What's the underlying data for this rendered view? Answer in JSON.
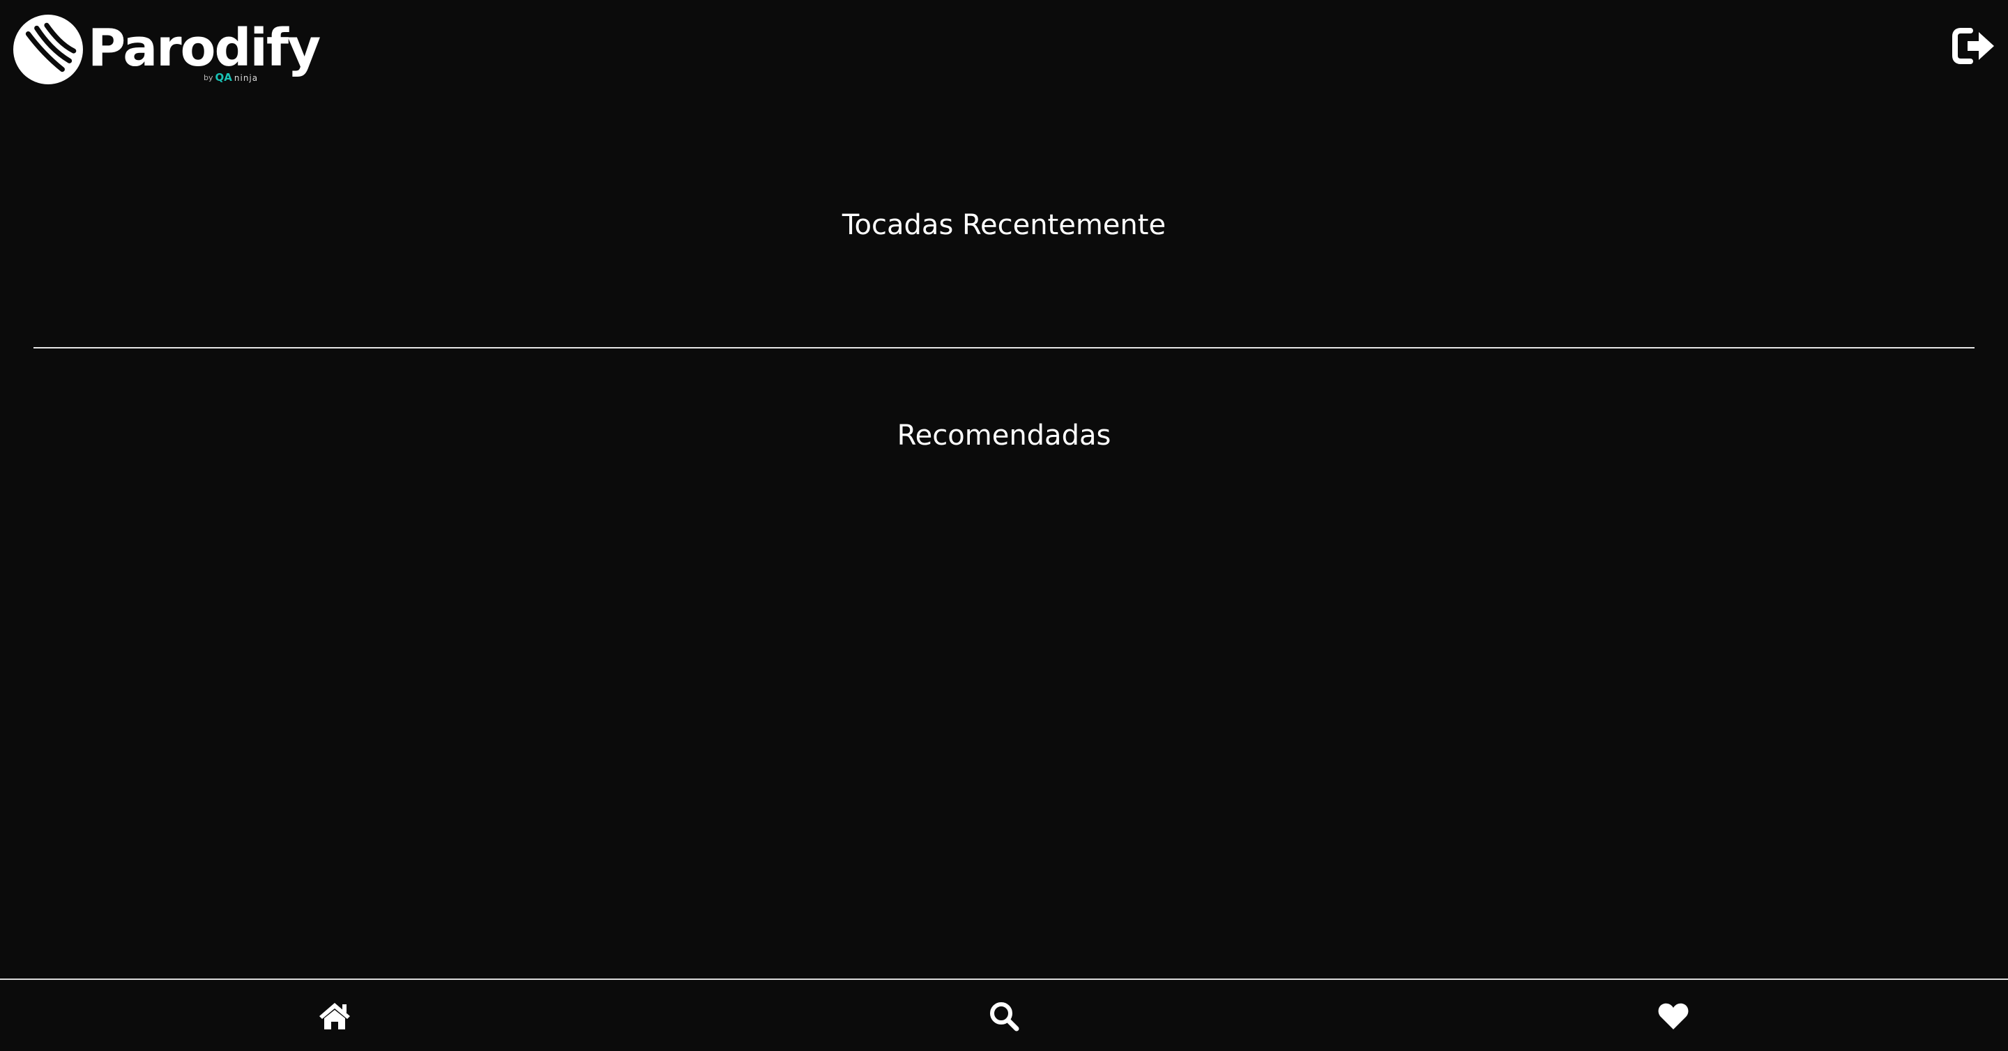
{
  "header": {
    "logo": {
      "name": "Parodify",
      "byline_prefix": "by",
      "byline_brand_accent": "QA",
      "byline_brand_rest": "ninja",
      "accent_color": "#19c2b5"
    },
    "logout_icon": "sign-out-icon"
  },
  "main": {
    "sections": [
      {
        "title": "Tocadas Recentemente"
      },
      {
        "title": "Recomendadas"
      }
    ]
  },
  "bottom_nav": {
    "items": [
      {
        "icon": "home-icon"
      },
      {
        "icon": "search-icon"
      },
      {
        "icon": "heart-icon"
      }
    ]
  },
  "colors": {
    "background": "#0b0b0b",
    "text": "#ffffff",
    "divider": "#e6e6e6"
  }
}
